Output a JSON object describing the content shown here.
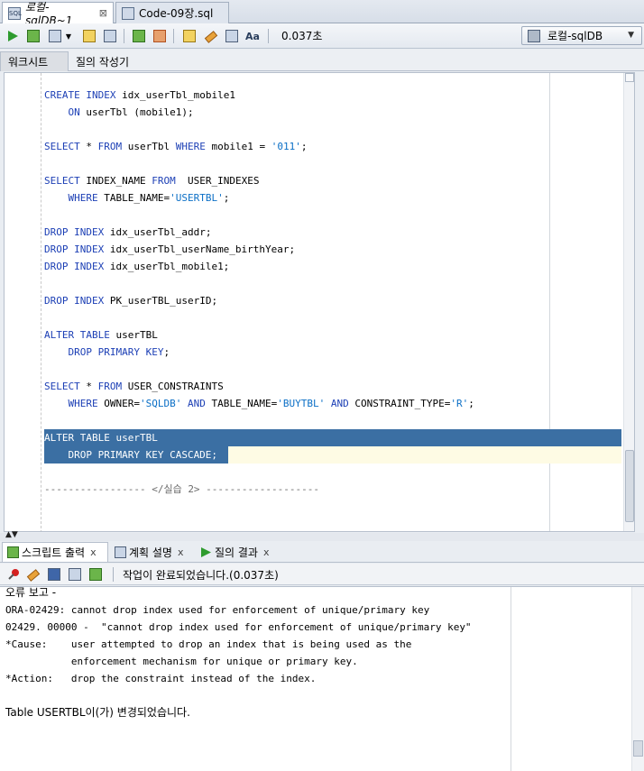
{
  "tabs": [
    {
      "label": "로컬-sqlDB~1",
      "active": true
    },
    {
      "label": "Code-09장.sql",
      "active": false
    }
  ],
  "toolbar": {
    "elapsed": "0.037초",
    "connection": "로컬-sqlDB"
  },
  "subtabs": [
    "워크시트",
    "질의 작성기"
  ],
  "editor": {
    "lines": [
      {
        "parts": [
          {
            "t": "CREATE INDEX",
            "c": "kw"
          },
          {
            "t": " idx_userTbl_mobile1",
            "c": ""
          }
        ]
      },
      {
        "parts": [
          {
            "t": "    ON",
            "c": "kw"
          },
          {
            "t": " userTbl (mobile1);",
            "c": ""
          }
        ]
      },
      {
        "parts": []
      },
      {
        "parts": [
          {
            "t": "SELECT",
            "c": "kw"
          },
          {
            "t": " * ",
            "c": ""
          },
          {
            "t": "FROM",
            "c": "kw"
          },
          {
            "t": " userTbl ",
            "c": ""
          },
          {
            "t": "WHERE",
            "c": "kw"
          },
          {
            "t": " mobile1 = ",
            "c": ""
          },
          {
            "t": "'011'",
            "c": "str"
          },
          {
            "t": ";",
            "c": ""
          }
        ]
      },
      {
        "parts": []
      },
      {
        "parts": [
          {
            "t": "SELECT",
            "c": "kw"
          },
          {
            "t": " INDEX_NAME ",
            "c": ""
          },
          {
            "t": "FROM",
            "c": "kw"
          },
          {
            "t": "  USER_INDEXES",
            "c": ""
          }
        ]
      },
      {
        "parts": [
          {
            "t": "    WHERE",
            "c": "kw"
          },
          {
            "t": " TABLE_NAME=",
            "c": ""
          },
          {
            "t": "'USERTBL'",
            "c": "str"
          },
          {
            "t": ";",
            "c": ""
          }
        ]
      },
      {
        "parts": []
      },
      {
        "parts": [
          {
            "t": "DROP INDEX",
            "c": "kw"
          },
          {
            "t": " idx_userTbl_addr;",
            "c": ""
          }
        ]
      },
      {
        "parts": [
          {
            "t": "DROP INDEX",
            "c": "kw"
          },
          {
            "t": " idx_userTbl_userName_birthYear;",
            "c": ""
          }
        ]
      },
      {
        "parts": [
          {
            "t": "DROP INDEX",
            "c": "kw"
          },
          {
            "t": " idx_userTbl_mobile1;",
            "c": ""
          }
        ]
      },
      {
        "parts": []
      },
      {
        "parts": [
          {
            "t": "DROP INDEX",
            "c": "kw"
          },
          {
            "t": " PK_userTBL_userID;",
            "c": ""
          }
        ]
      },
      {
        "parts": []
      },
      {
        "parts": [
          {
            "t": "ALTER TABLE",
            "c": "kw"
          },
          {
            "t": " userTBL",
            "c": ""
          }
        ]
      },
      {
        "parts": [
          {
            "t": "    DROP PRIMARY KEY",
            "c": "kw"
          },
          {
            "t": ";",
            "c": ""
          }
        ]
      },
      {
        "parts": []
      },
      {
        "parts": [
          {
            "t": "SELECT",
            "c": "kw"
          },
          {
            "t": " * ",
            "c": ""
          },
          {
            "t": "FROM",
            "c": "kw"
          },
          {
            "t": " USER_CONSTRAINTS",
            "c": ""
          }
        ]
      },
      {
        "parts": [
          {
            "t": "    WHERE",
            "c": "kw"
          },
          {
            "t": " OWNER=",
            "c": ""
          },
          {
            "t": "'SQLDB'",
            "c": "str"
          },
          {
            "t": " ",
            "c": ""
          },
          {
            "t": "AND",
            "c": "kw"
          },
          {
            "t": " TABLE_NAME=",
            "c": ""
          },
          {
            "t": "'BUYTBL'",
            "c": "str"
          },
          {
            "t": " ",
            "c": ""
          },
          {
            "t": "AND",
            "c": "kw"
          },
          {
            "t": " CONSTRAINT_TYPE=",
            "c": ""
          },
          {
            "t": "'R'",
            "c": "str"
          },
          {
            "t": ";",
            "c": ""
          }
        ]
      },
      {
        "parts": []
      },
      {
        "parts": [
          {
            "t": "ALTER TABLE userTBL",
            "c": "sel"
          }
        ]
      },
      {
        "parts": [
          {
            "t": "    DROP PRIMARY KEY CASCADE;",
            "c": "sel"
          }
        ]
      },
      {
        "parts": []
      },
      {
        "parts": [
          {
            "t": "----------------- </실습 2> -------------------",
            "c": "comment"
          }
        ]
      }
    ]
  },
  "output_tabs": [
    {
      "label": "스크립트 출력",
      "close": "x"
    },
    {
      "label": "계획 설명",
      "close": "x"
    },
    {
      "label": "질의 결과",
      "close": "x"
    }
  ],
  "output_status": "작업이 완료되었습니다.(0.037초)",
  "output": {
    "lines": [
      "오류 보고 -",
      "ORA-02429: cannot drop index used for enforcement of unique/primary key",
      "02429. 00000 -  \"cannot drop index used for enforcement of unique/primary key\"",
      "*Cause:    user attempted to drop an index that is being used as the",
      "           enforcement mechanism for unique or primary key.",
      "*Action:   drop the constraint instead of the index.",
      "",
      "Table USERTBL이(가) 변경되었습니다."
    ]
  }
}
